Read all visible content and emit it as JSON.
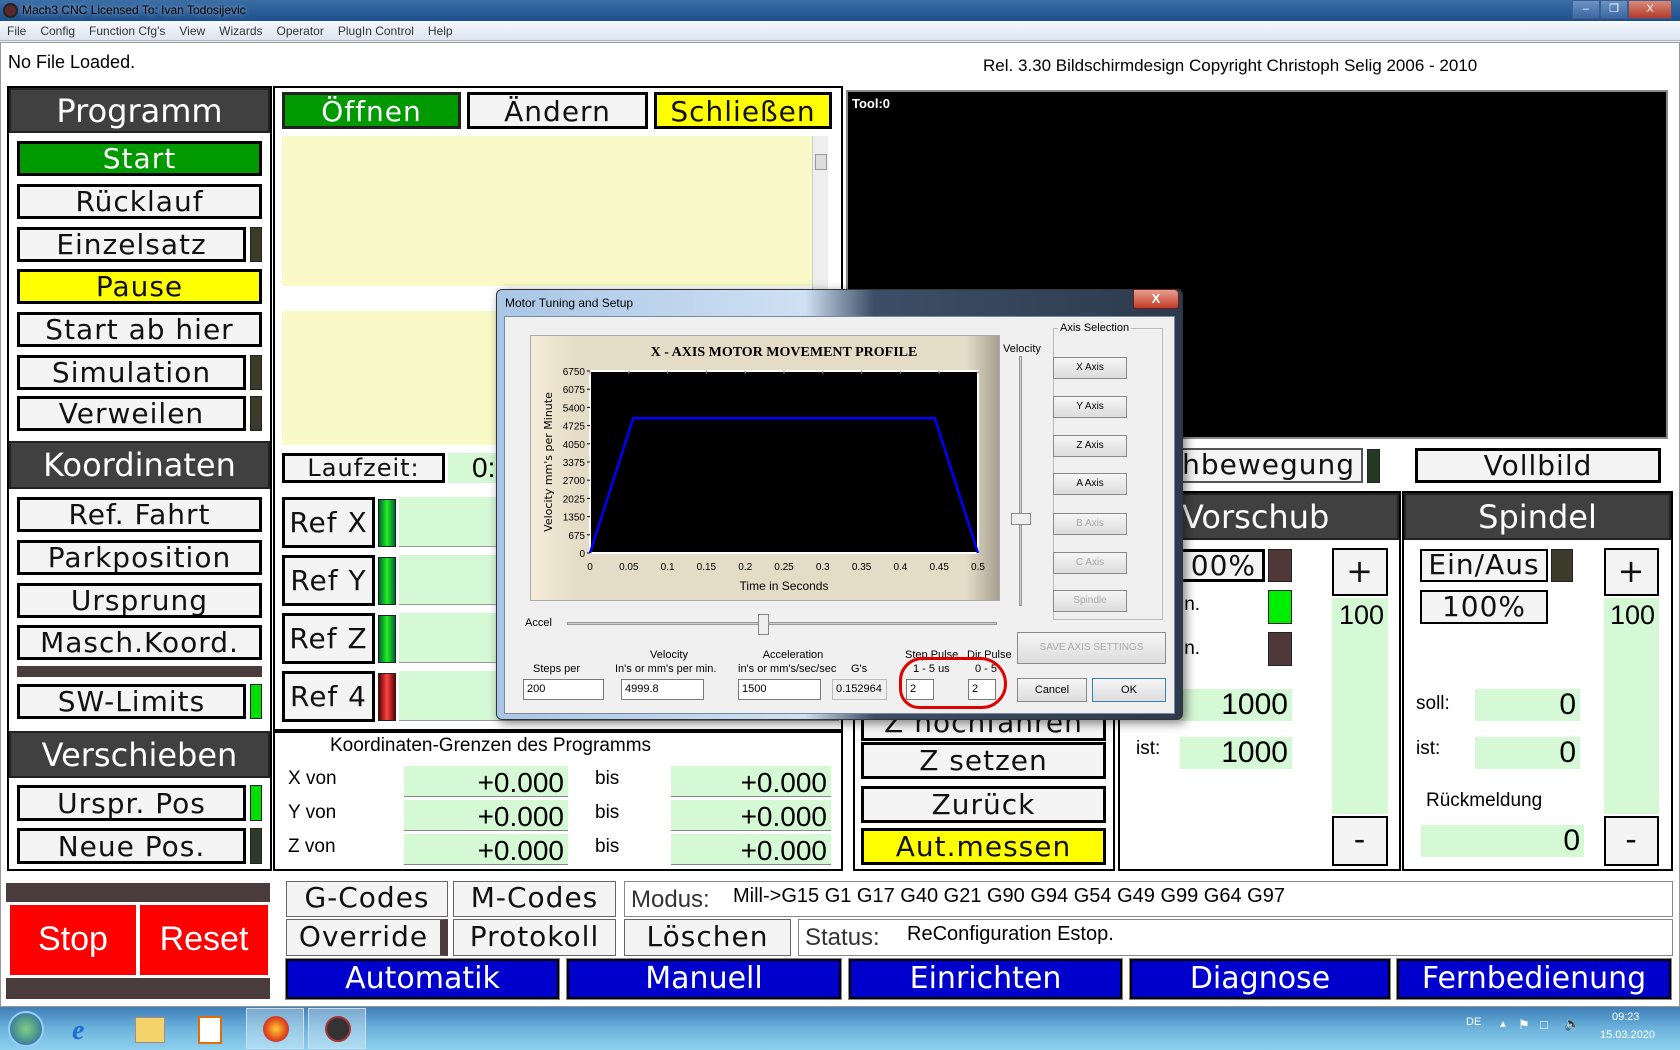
{
  "window": {
    "title": "Mach3 CNC  Licensed To: Ivan Todosijevic",
    "controls": [
      "minimize",
      "maximize",
      "close"
    ]
  },
  "menu": [
    "File",
    "Config",
    "Function Cfg's",
    "View",
    "Wizards",
    "Operator",
    "PlugIn Control",
    "Help"
  ],
  "file_status": "No File Loaded.",
  "copyright": "Rel. 3.30 Bildschirmdesign Copyright Christoph Selig 2006 - 2010",
  "program": {
    "header": "Programm",
    "buttons": [
      "Start",
      "Rücklauf",
      "Einzelsatz",
      "Pause",
      "Start ab hier",
      "Simulation",
      "Verweilen"
    ]
  },
  "file_buttons": {
    "open": "Öffnen",
    "edit": "Ändern",
    "close": "Schließen"
  },
  "runtime": {
    "label": "Laufzeit:",
    "value": "0:"
  },
  "coords": {
    "header": "Koordinaten",
    "buttons": [
      "Ref. Fahrt",
      "Parkposition",
      "Ursprung",
      "Masch.Koord.",
      "SW-Limits"
    ]
  },
  "shift": {
    "header": "Verschieben",
    "buttons": [
      "Urspr. Pos",
      "Neue Pos."
    ]
  },
  "refs": [
    {
      "label": "Ref X",
      "led": "green"
    },
    {
      "label": "Ref Y",
      "led": "green"
    },
    {
      "label": "Ref Z",
      "led": "green"
    },
    {
      "label": "Ref 4",
      "led": "red"
    }
  ],
  "limits": {
    "title": "Koordinaten-Grenzen des Programms",
    "bis": "bis",
    "rows": [
      {
        "label": "X von",
        "from": "+0.000",
        "to": "+0.000"
      },
      {
        "label": "Y von",
        "from": "+0.000",
        "to": "+0.000"
      },
      {
        "label": "Z von",
        "from": "+0.000",
        "to": "+0.000"
      }
    ]
  },
  "tool_display": "Tool:0",
  "z_buttons": [
    "Z hochfahren",
    "Z setzen",
    "Zurück",
    "Aut.messen"
  ],
  "view": {
    "jog": "hbewegung",
    "fullscreen": "Vollbild"
  },
  "feed": {
    "header": "Vorschub",
    "percent": "00%",
    "min1": "in.",
    "min2": "in.",
    "soll": "1000",
    "ist_label": "ist:",
    "ist": "1000",
    "plus": "+",
    "minus": "-",
    "override": "100"
  },
  "spindle": {
    "header": "Spindel",
    "onoff": "Ein/Aus",
    "percent": "100%",
    "soll_label": "soll:",
    "soll": "0",
    "ist_label": "ist:",
    "ist": "0",
    "feedback_label": "Rückmeldung",
    "feedback": "0",
    "plus": "+",
    "minus": "-",
    "override": "100"
  },
  "bottom": {
    "stop": "Stop",
    "reset": "Reset",
    "gcodes": "G-Codes",
    "mcodes": "M-Codes",
    "override": "Override",
    "protocol": "Protokoll",
    "clear": "Löschen",
    "modus_label": "Modus:",
    "modus": "Mill->G15  G1 G17 G40 G21 G90 G94 G54 G49 G99 G64 G97",
    "status_label": "Status:",
    "status": "ReConfiguration Estop."
  },
  "tabs": [
    "Automatik",
    "Manuell",
    "Einrichten",
    "Diagnose",
    "Fernbedienung"
  ],
  "tray": {
    "lang": "DE",
    "time": "09:23",
    "date": "15.03.2020"
  },
  "dialog": {
    "title": "Motor Tuning and Setup",
    "velocity_slider_label": "Velocity",
    "accel_slider_label": "Accel",
    "axis_group": "Axis Selection",
    "axes": [
      {
        "label": "X Axis",
        "enabled": true
      },
      {
        "label": "Y Axis",
        "enabled": true
      },
      {
        "label": "Z Axis",
        "enabled": true
      },
      {
        "label": "A Axis",
        "enabled": true
      },
      {
        "label": "B Axis",
        "enabled": false
      },
      {
        "label": "C Axis",
        "enabled": false
      },
      {
        "label": "Spindle",
        "enabled": false
      }
    ],
    "save": "SAVE AXIS SETTINGS",
    "fields": {
      "steps_label": "Steps per",
      "steps": "200",
      "vel_label1": "Velocity",
      "vel_label2": "In's or mm's per min.",
      "velocity": "4999.8",
      "acc_label1": "Acceleration",
      "acc_label2": "in's or mm's/sec/sec",
      "acceleration": "1500",
      "gs_label": "G's",
      "gs": "0.152964",
      "step_label1": "Step Pulse",
      "step_label2": "1 - 5 us",
      "step_pulse": "2",
      "dir_label1": "Dir Pulse",
      "dir_label2": "0 - 5",
      "dir_pulse": "2"
    },
    "cancel": "Cancel",
    "ok": "OK",
    "annotation_color": "#e00000"
  },
  "chart_data": {
    "type": "line",
    "title": "X - AXIS MOTOR MOVEMENT PROFILE",
    "xlabel": "Time in Seconds",
    "ylabel": "Velocity mm's per Minute",
    "xlim": [
      0,
      0.5
    ],
    "ylim": [
      0,
      6750
    ],
    "xticks": [
      "0",
      "0.05",
      "0.1",
      "0.15",
      "0.2",
      "0.25",
      "0.3",
      "0.35",
      "0.4",
      "0.45",
      "0.5"
    ],
    "yticks": [
      "0",
      "675",
      "1350",
      "2025",
      "2700",
      "3375",
      "4050",
      "4725",
      "5400",
      "6075",
      "6750"
    ],
    "x": [
      0,
      0.0556,
      0.4444,
      0.5
    ],
    "y": [
      0,
      4999.8,
      4999.8,
      0
    ],
    "line_color": "#0000ff",
    "background": "#000000"
  }
}
